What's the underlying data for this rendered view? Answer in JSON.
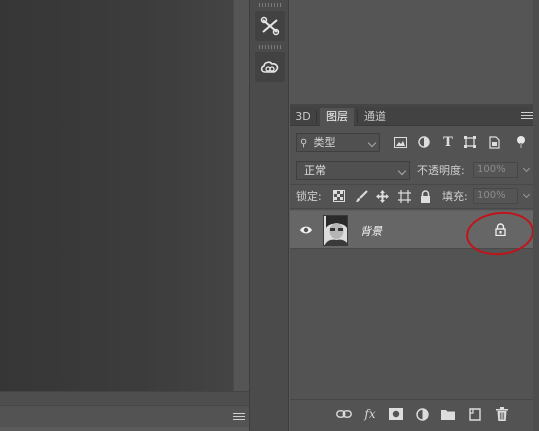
{
  "tabs": [
    {
      "label": "3D",
      "active": false
    },
    {
      "label": "图层",
      "active": true
    },
    {
      "label": "通道",
      "active": false
    }
  ],
  "filter": {
    "kind_label": "类型",
    "icons": [
      "image-filter-icon",
      "adjustment-filter-icon",
      "type-filter-icon",
      "shape-filter-icon",
      "smart-object-filter-icon"
    ]
  },
  "blend_mode": {
    "value": "正常"
  },
  "opacity": {
    "label": "不透明度:",
    "value": "100%"
  },
  "lock": {
    "label": "锁定:"
  },
  "fill": {
    "label": "填充:",
    "value": "100%"
  },
  "layers": [
    {
      "name": "背景",
      "visible": true,
      "locked": true
    }
  ],
  "bottom_icons": [
    "link-layers-icon",
    "fx-icon",
    "add-mask-icon",
    "adjustment-layer-icon",
    "group-folder-icon",
    "new-layer-icon",
    "delete-trash-icon"
  ],
  "bottom_fx_label": "fx",
  "colors": {
    "panel_bg": "#535353",
    "tab_bar": "#424242",
    "selected_layer": "#666666",
    "annotation_red": "#c0141b"
  }
}
